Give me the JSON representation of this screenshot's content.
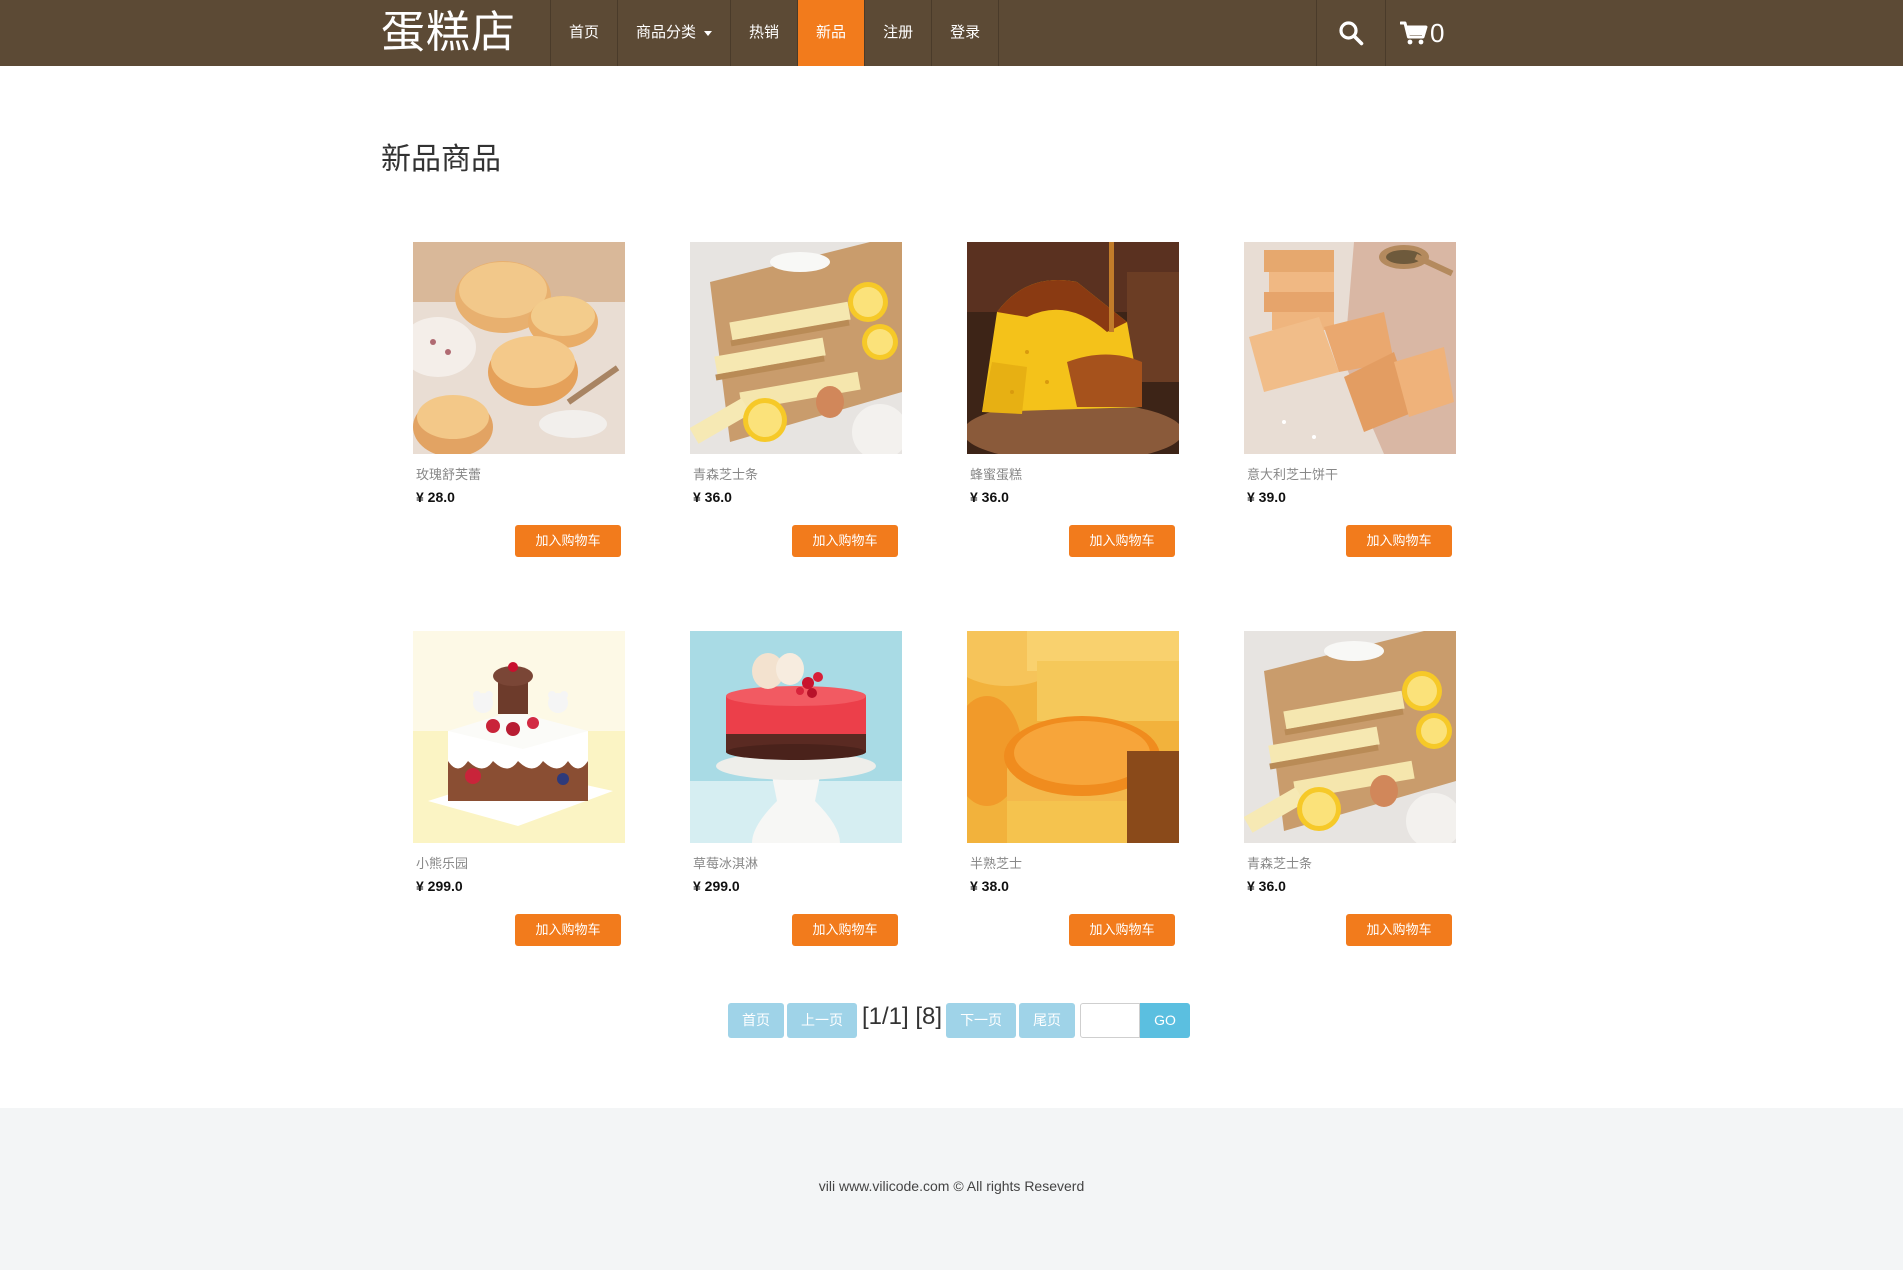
{
  "header": {
    "brand": "蛋糕店",
    "nav": [
      {
        "label": "首页",
        "active": false
      },
      {
        "label": "商品分类",
        "active": false,
        "dropdown": true
      },
      {
        "label": "热销",
        "active": false
      },
      {
        "label": "新品",
        "active": true
      },
      {
        "label": "注册",
        "active": false
      },
      {
        "label": "登录",
        "active": false
      }
    ],
    "search_icon": "search-icon",
    "cart_icon": "cart-icon",
    "cart_count": "0"
  },
  "section_title": "新品商品",
  "products": [
    {
      "name": "玫瑰舒芙蕾",
      "price": "¥ 28.0",
      "button": "加入购物车",
      "image": "rose-souffle"
    },
    {
      "name": "青森芝士条",
      "price": "¥ 36.0",
      "button": "加入购物车",
      "image": "cheese-bars"
    },
    {
      "name": "蜂蜜蛋糕",
      "price": "¥ 36.0",
      "button": "加入购物车",
      "image": "honey-cake"
    },
    {
      "name": "意大利芝士饼干",
      "price": "¥ 39.0",
      "button": "加入购物车",
      "image": "cheese-biscuits"
    },
    {
      "name": "小熊乐园",
      "price": "¥ 299.0",
      "button": "加入购物车",
      "image": "bear-cake"
    },
    {
      "name": "草莓冰淇淋",
      "price": "¥ 299.0",
      "button": "加入购物车",
      "image": "strawberry-ice-cream-cake"
    },
    {
      "name": "半熟芝士",
      "price": "¥ 38.0",
      "button": "加入购物车",
      "image": "half-baked-cheese"
    },
    {
      "name": "青森芝士条",
      "price": "¥ 36.0",
      "button": "加入购物车",
      "image": "cheese-bars"
    }
  ],
  "pagination": {
    "first": "首页",
    "prev": "上一页",
    "info": "[1/1] [8]",
    "next": "下一页",
    "last": "尾页",
    "go": "GO",
    "input_value": ""
  },
  "footer": {
    "text": "vili www.vilicode.com © All rights Reseverd"
  },
  "colors": {
    "navbar": "#5c4a35",
    "accent": "#f27b1c",
    "pager_btn": "#9fd3e8",
    "pager_go": "#5bbfe0",
    "footer_bg": "#f3f5f6"
  }
}
